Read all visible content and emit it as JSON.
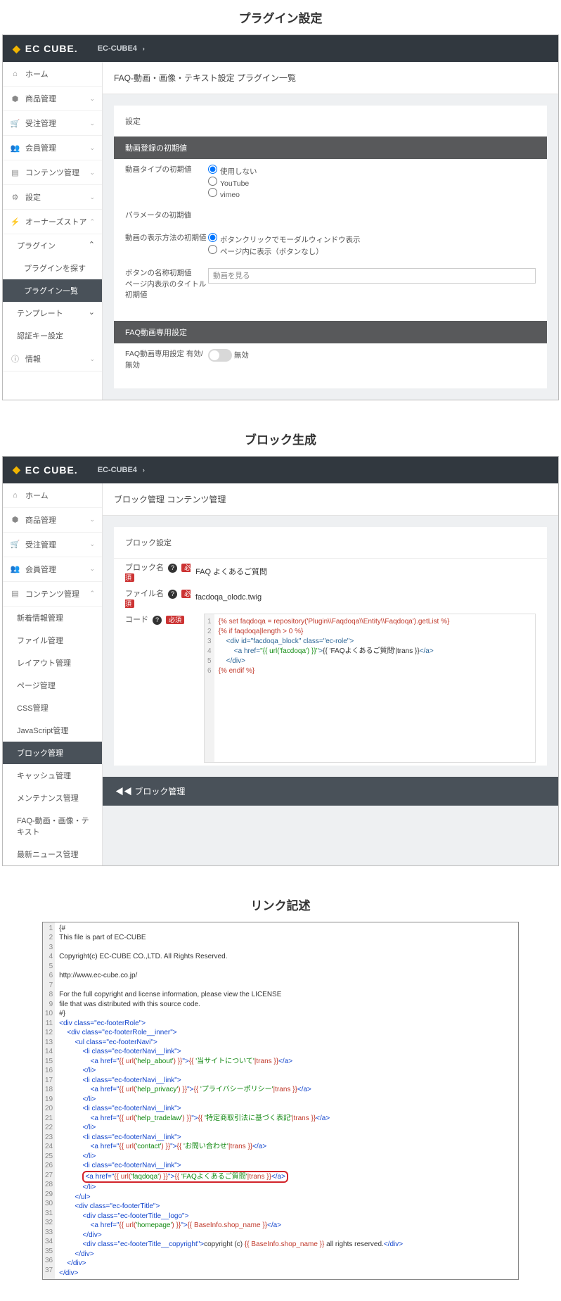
{
  "sections": {
    "plugin": "プラグイン設定",
    "block": "ブロック生成",
    "link": "リンク記述"
  },
  "logo": "EC CUBE.",
  "eclink": "EC-CUBE4",
  "side1": {
    "home": "ホーム",
    "product": "商品管理",
    "order": "受注管理",
    "member": "会員管理",
    "content": "コンテンツ管理",
    "setting": "設定",
    "store": "オーナーズストア",
    "plugin": "プラグイン",
    "plugin_search": "プラグインを探す",
    "plugin_list": "プラグイン一覧",
    "template": "テンプレート",
    "auth": "認証キー設定",
    "info": "情報"
  },
  "p1": {
    "bc": "FAQ-動画・画像・テキスト設定 プラグイン一覧",
    "setting": "設定",
    "hdr1": "動画登録の初期値",
    "k_type": "動画タイプの初期値",
    "opt_none": "使用しない",
    "opt_yt": "YouTube",
    "opt_vimeo": "vimeo",
    "k_param": "パラメータの初期値",
    "k_disp": "動画の表示方法の初期値",
    "opt_modal": "ボタンクリックでモーダルウィンドウ表示",
    "opt_inline": "ページ内に表示（ボタンなし）",
    "k_btnname": "ボタンの名称初期値\nページ内表示のタイトル初期値",
    "btnname_val": "動画を見る",
    "hdr2": "FAQ動画専用設定",
    "k_onoff": "FAQ動画専用設定 有効/無効",
    "off": "無効"
  },
  "side2": {
    "home": "ホーム",
    "product": "商品管理",
    "order": "受注管理",
    "member": "会員管理",
    "content": "コンテンツ管理",
    "news": "新着情報管理",
    "file": "ファイル管理",
    "layout": "レイアウト管理",
    "page": "ページ管理",
    "css": "CSS管理",
    "js": "JavaScript管理",
    "block": "ブロック管理",
    "cache": "キャッシュ管理",
    "maint": "メンテナンス管理",
    "faq": "FAQ-動画・画像・テキスト",
    "update": "最新ニュース管理"
  },
  "p2": {
    "bc": "ブロック管理 コンテンツ管理",
    "hdr": "ブロック設定",
    "k_name": "ブロック名",
    "v_name": "FAQ よくあるご質問",
    "k_file": "ファイル名",
    "v_file": "facdoqa_olodc.twig",
    "k_code": "コード",
    "code": [
      "{% set faqdoqa = repository('Plugin\\\\Faqdoqa\\\\Entity\\\\Faqdoqa').getList %}",
      "{% if faqdoqa|length > 0 %}",
      "    <div id=\"facdoqa_block\" class=\"ec-role\">",
      "        <a href=\"{{ url('facdoqa') }}\">{{ 'FAQよくあるご質問'|trans }}</a>",
      "    </div>",
      "{% endif %}"
    ],
    "footer": "◀◀ ブロック管理"
  },
  "p3": {
    "lines": [
      "{#",
      "This file is part of EC-CUBE",
      "",
      "Copyright(c) EC-CUBE CO.,LTD. All Rights Reserved.",
      "",
      "http://www.ec-cube.co.jp/",
      "",
      "For the full copyright and license information, please view the LICENSE",
      "file that was distributed with this source code.",
      "#}",
      "<div class=\"ec-footerRole\">",
      "    <div class=\"ec-footerRole__inner\">",
      "        <ul class=\"ec-footerNavi\">",
      "            <li class=\"ec-footerNavi__link\">",
      "                <a href=\"{{ url('help_about') }}\">{{ '当サイトについて'|trans }}</a>",
      "            </li>",
      "            <li class=\"ec-footerNavi__link\">",
      "                <a href=\"{{ url('help_privacy') }}\">{{ 'プライバシーポリシー'|trans }}</a>",
      "            </li>",
      "            <li class=\"ec-footerNavi__link\">",
      "                <a href=\"{{ url('help_tradelaw') }}\">{{ '特定商取引法に基づく表記'|trans }}</a>",
      "            </li>",
      "            <li class=\"ec-footerNavi__link\">",
      "                <a href=\"{{ url('contact') }}\">{{ 'お問い合わせ'|trans }}</a>",
      "            </li>",
      "            <li class=\"ec-footerNavi__link\">",
      "                <a href=\"{{ url('faqdoqa') }}\">{{ 'FAQよくあるご質問'|trans }}</a>",
      "            </li>",
      "        </ul>",
      "        <div class=\"ec-footerTitle\">",
      "            <div class=\"ec-footerTitle__logo\">",
      "                <a href=\"{{ url('homepage') }}\">{{ BaseInfo.shop_name }}</a>",
      "            </div>",
      "            <div class=\"ec-footerTitle__copyright\">copyright (c) {{ BaseInfo.shop_name }} all rights reserved.</div>",
      "        </div>",
      "    </div>",
      "</div>"
    ],
    "hl_index": 26
  }
}
